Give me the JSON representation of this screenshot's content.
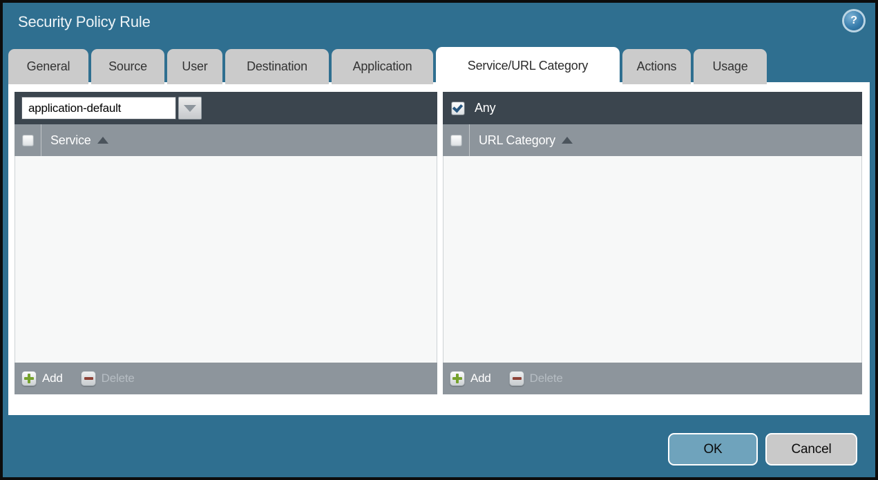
{
  "dialog": {
    "title": "Security Policy Rule"
  },
  "icons": {
    "help_glyph": "?"
  },
  "tabs": [
    {
      "label": "General",
      "active": false
    },
    {
      "label": "Source",
      "active": false
    },
    {
      "label": "User",
      "active": false
    },
    {
      "label": "Destination",
      "active": false
    },
    {
      "label": "Application",
      "active": false
    },
    {
      "label": "Service/URL Category",
      "active": true
    },
    {
      "label": "Actions",
      "active": false
    },
    {
      "label": "Usage",
      "active": false
    }
  ],
  "service_panel": {
    "dropdown_value": "application-default",
    "column_header": "Service",
    "header_checkbox_checked": false,
    "sort": "ascending",
    "rows": [],
    "add_label": "Add",
    "delete_label": "Delete",
    "delete_enabled": false
  },
  "url_category_panel": {
    "any_label": "Any",
    "any_checked": true,
    "column_header": "URL Category",
    "header_checkbox_checked": false,
    "sort": "ascending",
    "rows": [],
    "add_label": "Add",
    "delete_label": "Delete",
    "delete_enabled": false
  },
  "footer": {
    "ok_label": "OK",
    "cancel_label": "Cancel"
  },
  "colors": {
    "dialog_background": "#2f6f90",
    "outer_border": "#0c0c0c",
    "panel_topbar": "#3b454e",
    "panel_header": "#8d959c",
    "panel_body": "#f7f8f8",
    "tab_inactive": "#cbcbcb",
    "tab_active": "#ffffff",
    "ok_button": "#6fa3bc",
    "cancel_button": "#c9c9c9",
    "add_icon_green": "#76a22d",
    "delete_icon_red": "#8e4338",
    "checkmark_blue": "#27567f"
  }
}
